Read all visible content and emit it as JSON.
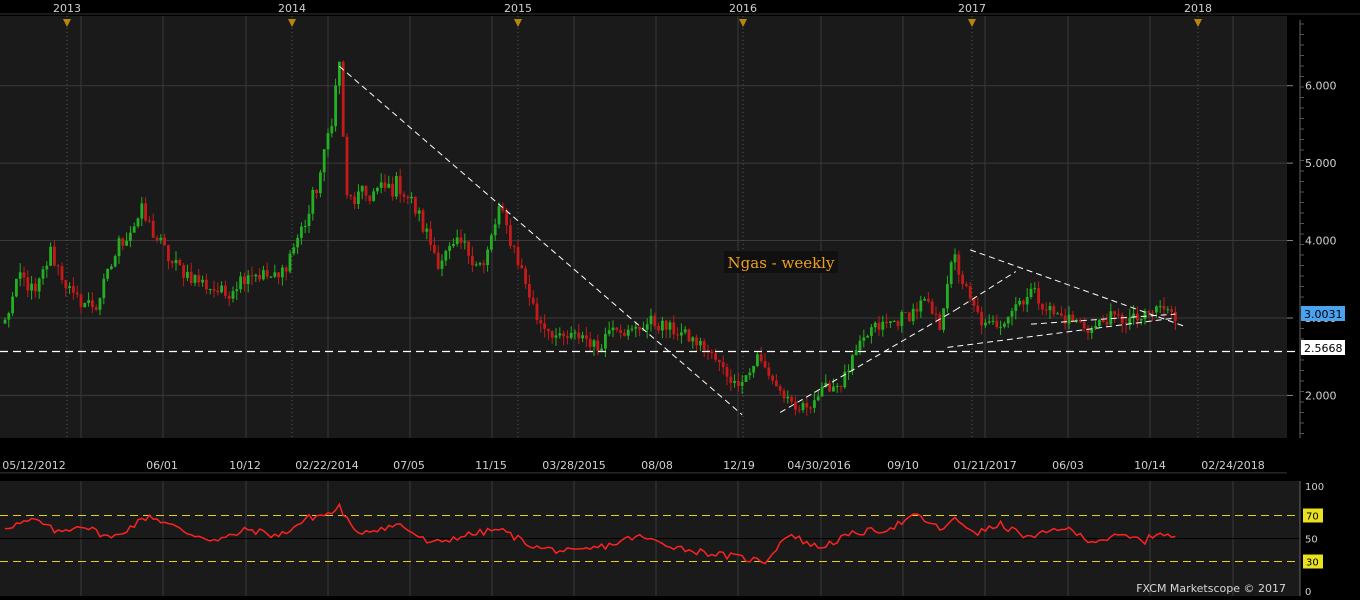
{
  "colors": {
    "background": "#000000",
    "panel": "#1a1a1a",
    "grid": "#3a3a3a",
    "candle_up": "#22b022",
    "candle_down": "#c41a1a",
    "rsi_line": "#ff2222",
    "rsi_band": "#e0d020",
    "trend_line": "#ffffff",
    "marker": "#b8860b",
    "price_tag_current": "#4aa3f0"
  },
  "chart_data": [
    {
      "type": "candlestick",
      "title": "Ngas - weekly",
      "year_labels": [
        "2013",
        "2014",
        "2015",
        "2016",
        "2017",
        "2018"
      ],
      "x_tick_labels": [
        "05/12/2012",
        "06/01",
        "10/12",
        "02/22/2014",
        "07/05",
        "11/15",
        "03/28/2015",
        "08/08",
        "12/19",
        "04/30/2016",
        "09/10",
        "01/21/2017",
        "06/03",
        "10/14",
        "02/24/2018"
      ],
      "y_tick_labels": [
        "2.000",
        "3.000",
        "4.000",
        "5.000",
        "6.000"
      ],
      "y_range": [
        1.45,
        6.9
      ],
      "price_levels": [
        {
          "label": "3.0031",
          "value": 3.0031,
          "style": "current"
        },
        {
          "label": "2.5668",
          "value": 2.5668,
          "style": "dashed-horizontal"
        }
      ],
      "anchors": [
        [
          2.95,
          0
        ],
        [
          3.55,
          4
        ],
        [
          3.3,
          8
        ],
        [
          3.85,
          12
        ],
        [
          3.25,
          18
        ],
        [
          3.15,
          24
        ],
        [
          3.95,
          30
        ],
        [
          4.35,
          36
        ],
        [
          3.7,
          44
        ],
        [
          3.45,
          52
        ],
        [
          3.3,
          58
        ],
        [
          3.6,
          64
        ],
        [
          3.5,
          72
        ],
        [
          4.35,
          80
        ],
        [
          5.05,
          84
        ],
        [
          6.25,
          88
        ],
        [
          4.5,
          90
        ],
        [
          4.6,
          96
        ],
        [
          4.72,
          104
        ],
        [
          4.4,
          108
        ],
        [
          3.75,
          114
        ],
        [
          3.95,
          120
        ],
        [
          3.65,
          126
        ],
        [
          4.4,
          130
        ],
        [
          3.9,
          134
        ],
        [
          3.0,
          140
        ],
        [
          2.72,
          146
        ],
        [
          2.78,
          152
        ],
        [
          2.6,
          156
        ],
        [
          2.95,
          160
        ],
        [
          2.8,
          164
        ],
        [
          2.95,
          170
        ],
        [
          2.8,
          178
        ],
        [
          2.62,
          184
        ],
        [
          2.4,
          188
        ],
        [
          2.15,
          192
        ],
        [
          2.3,
          196
        ],
        [
          2.5,
          198
        ],
        [
          2.05,
          204
        ],
        [
          1.8,
          208
        ],
        [
          1.9,
          212
        ],
        [
          2.1,
          216
        ],
        [
          2.15,
          220
        ],
        [
          2.55,
          224
        ],
        [
          2.85,
          228
        ],
        [
          2.95,
          234
        ],
        [
          3.05,
          238
        ],
        [
          3.2,
          242
        ],
        [
          2.9,
          246
        ],
        [
          3.5,
          248
        ],
        [
          3.75,
          250
        ],
        [
          3.2,
          254
        ],
        [
          2.88,
          258
        ],
        [
          2.95,
          262
        ],
        [
          3.18,
          266
        ],
        [
          3.35,
          270
        ],
        [
          3.05,
          276
        ],
        [
          2.95,
          282
        ],
        [
          2.85,
          286
        ],
        [
          3.0,
          290
        ],
        [
          2.97,
          296
        ],
        [
          3.0,
          300
        ],
        [
          3.15,
          304
        ],
        [
          3.0,
          308
        ]
      ],
      "rsi": {
        "y_range": [
          0,
          100
        ],
        "y_tick_labels": [
          "100",
          "70",
          "50",
          "30",
          "0"
        ],
        "levels": [
          70,
          50,
          30
        ],
        "anchors": [
          [
            60,
            0
          ],
          [
            66,
            8
          ],
          [
            55,
            14
          ],
          [
            62,
            20
          ],
          [
            50,
            28
          ],
          [
            70,
            38
          ],
          [
            55,
            48
          ],
          [
            48,
            56
          ],
          [
            58,
            64
          ],
          [
            52,
            72
          ],
          [
            68,
            80
          ],
          [
            72,
            86
          ],
          [
            78,
            88
          ],
          [
            55,
            92
          ],
          [
            62,
            104
          ],
          [
            45,
            112
          ],
          [
            52,
            120
          ],
          [
            58,
            130
          ],
          [
            42,
            140
          ],
          [
            38,
            150
          ],
          [
            45,
            160
          ],
          [
            52,
            166
          ],
          [
            40,
            180
          ],
          [
            35,
            190
          ],
          [
            30,
            200
          ],
          [
            54,
            206
          ],
          [
            42,
            214
          ],
          [
            55,
            224
          ],
          [
            58,
            232
          ],
          [
            70,
            240
          ],
          [
            58,
            246
          ],
          [
            66,
            250
          ],
          [
            55,
            256
          ],
          [
            62,
            262
          ],
          [
            50,
            270
          ],
          [
            60,
            278
          ],
          [
            48,
            286
          ],
          [
            52,
            294
          ],
          [
            48,
            300
          ],
          [
            56,
            304
          ],
          [
            50,
            308
          ]
        ]
      }
    }
  ],
  "footer": {
    "credit": "FXCM Marketscope © 2017"
  }
}
